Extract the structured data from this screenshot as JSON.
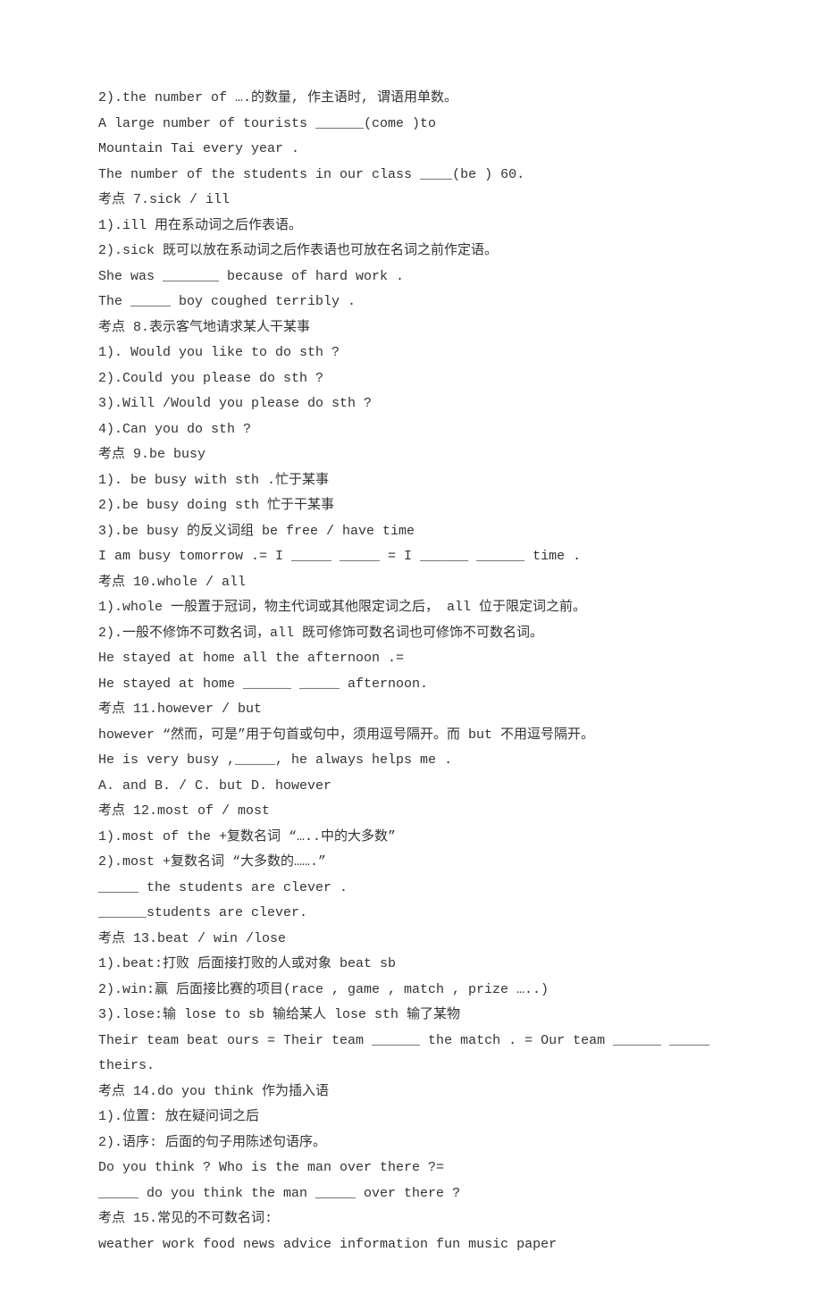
{
  "lines": [
    "2).the number of ….的数量, 作主语时, 谓语用单数。",
    "A large number of tourists ______(come )to",
    "Mountain Tai every year .",
    "The number of the students in our class ____(be ) 60.",
    "考点 7.sick / ill",
    "1).ill 用在系动词之后作表语。",
    "2).sick 既可以放在系动词之后作表语也可放在名词之前作定语。",
    "She was _______ because of hard work .",
    "The _____ boy coughed terribly .",
    "考点 8.表示客气地请求某人干某事",
    "1). Would you like to do sth ?",
    "2).Could you please do sth ?",
    "3).Will /Would you please do sth ?",
    "4).Can you do sth ?",
    "考点 9.be busy",
    "1). be busy with sth .忙于某事",
    "2).be busy doing sth 忙于干某事",
    "3).be busy 的反义词组 be free / have time",
    "I am busy tomorrow .= I _____ _____ = I ______ ______ time .",
    "考点 10.whole / all",
    "1).whole 一般置于冠词，物主代词或其他限定词之后， all 位于限定词之前。",
    "2).一般不修饰不可数名词，all 既可修饰可数名词也可修饰不可数名词。",
    "He stayed at home all the afternoon .=",
    "He stayed at home ______ _____ afternoon.",
    "考点 11.however / but",
    "however “然而，可是”用于句首或句中，须用逗号隔开。而 but 不用逗号隔开。",
    "He is very busy ,_____, he always helps me .",
    "A. and B. / C. but D. however",
    "考点 12.most of / most",
    "1).most of the +复数名词 “…..中的大多数”",
    "2).most +复数名词 “大多数的…….”",
    "_____ the students are clever .",
    "______students are clever.",
    "考点 13.beat / win /lose",
    "1).beat:打败 后面接打败的人或对象 beat sb",
    "2).win:赢 后面接比赛的项目(race , game , match , prize …..)",
    "3).lose:输 lose to sb 输给某人 lose sth 输了某物",
    "Their team beat ours = Their team ______ the match . = Our team ______ _____ theirs.",
    "考点 14.do you think 作为插入语",
    "1).位置: 放在疑问词之后",
    "2).语序: 后面的句子用陈述句语序。",
    "Do you think ? Who is the man over there ?=",
    "_____ do you think the man _____ over there ?",
    "考点 15.常见的不可数名词:",
    "weather work food news advice information fun music paper"
  ]
}
